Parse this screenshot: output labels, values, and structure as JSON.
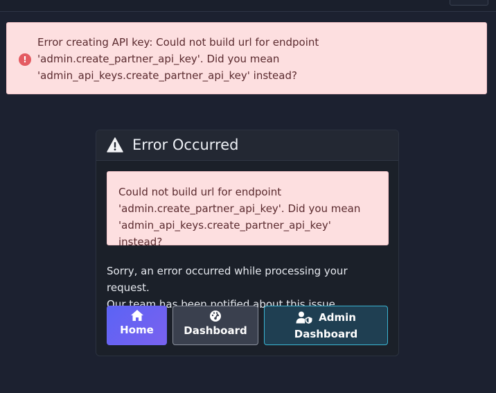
{
  "flash": {
    "icon": "exclamation-circle-icon",
    "message": "Error creating API key: Could not build url for endpoint\n'admin.create_partner_api_key'. Did you mean\n'admin_api_keys.create_partner_api_key' instead?"
  },
  "card": {
    "icon": "warning-triangle-icon",
    "title": "Error Occurred",
    "error_detail": "Could not build url for endpoint\n'admin.create_partner_api_key'. Did you mean\n'admin_api_keys.create_partner_api_key' instead?",
    "apology": "Sorry, an error occurred while processing your request.\nOur team has been notified about this issue."
  },
  "buttons": {
    "home_label": "Home",
    "dashboard_label": "Dashboard",
    "admin_label_line1": "Admin",
    "admin_label_line2": "Dashboard"
  },
  "colors": {
    "background": "#1c2130",
    "alert_bg": "#fddfe0",
    "alert_text": "#5a2a2e",
    "home_button": "#5b63f5",
    "admin_button_border": "#3ab5d3"
  }
}
